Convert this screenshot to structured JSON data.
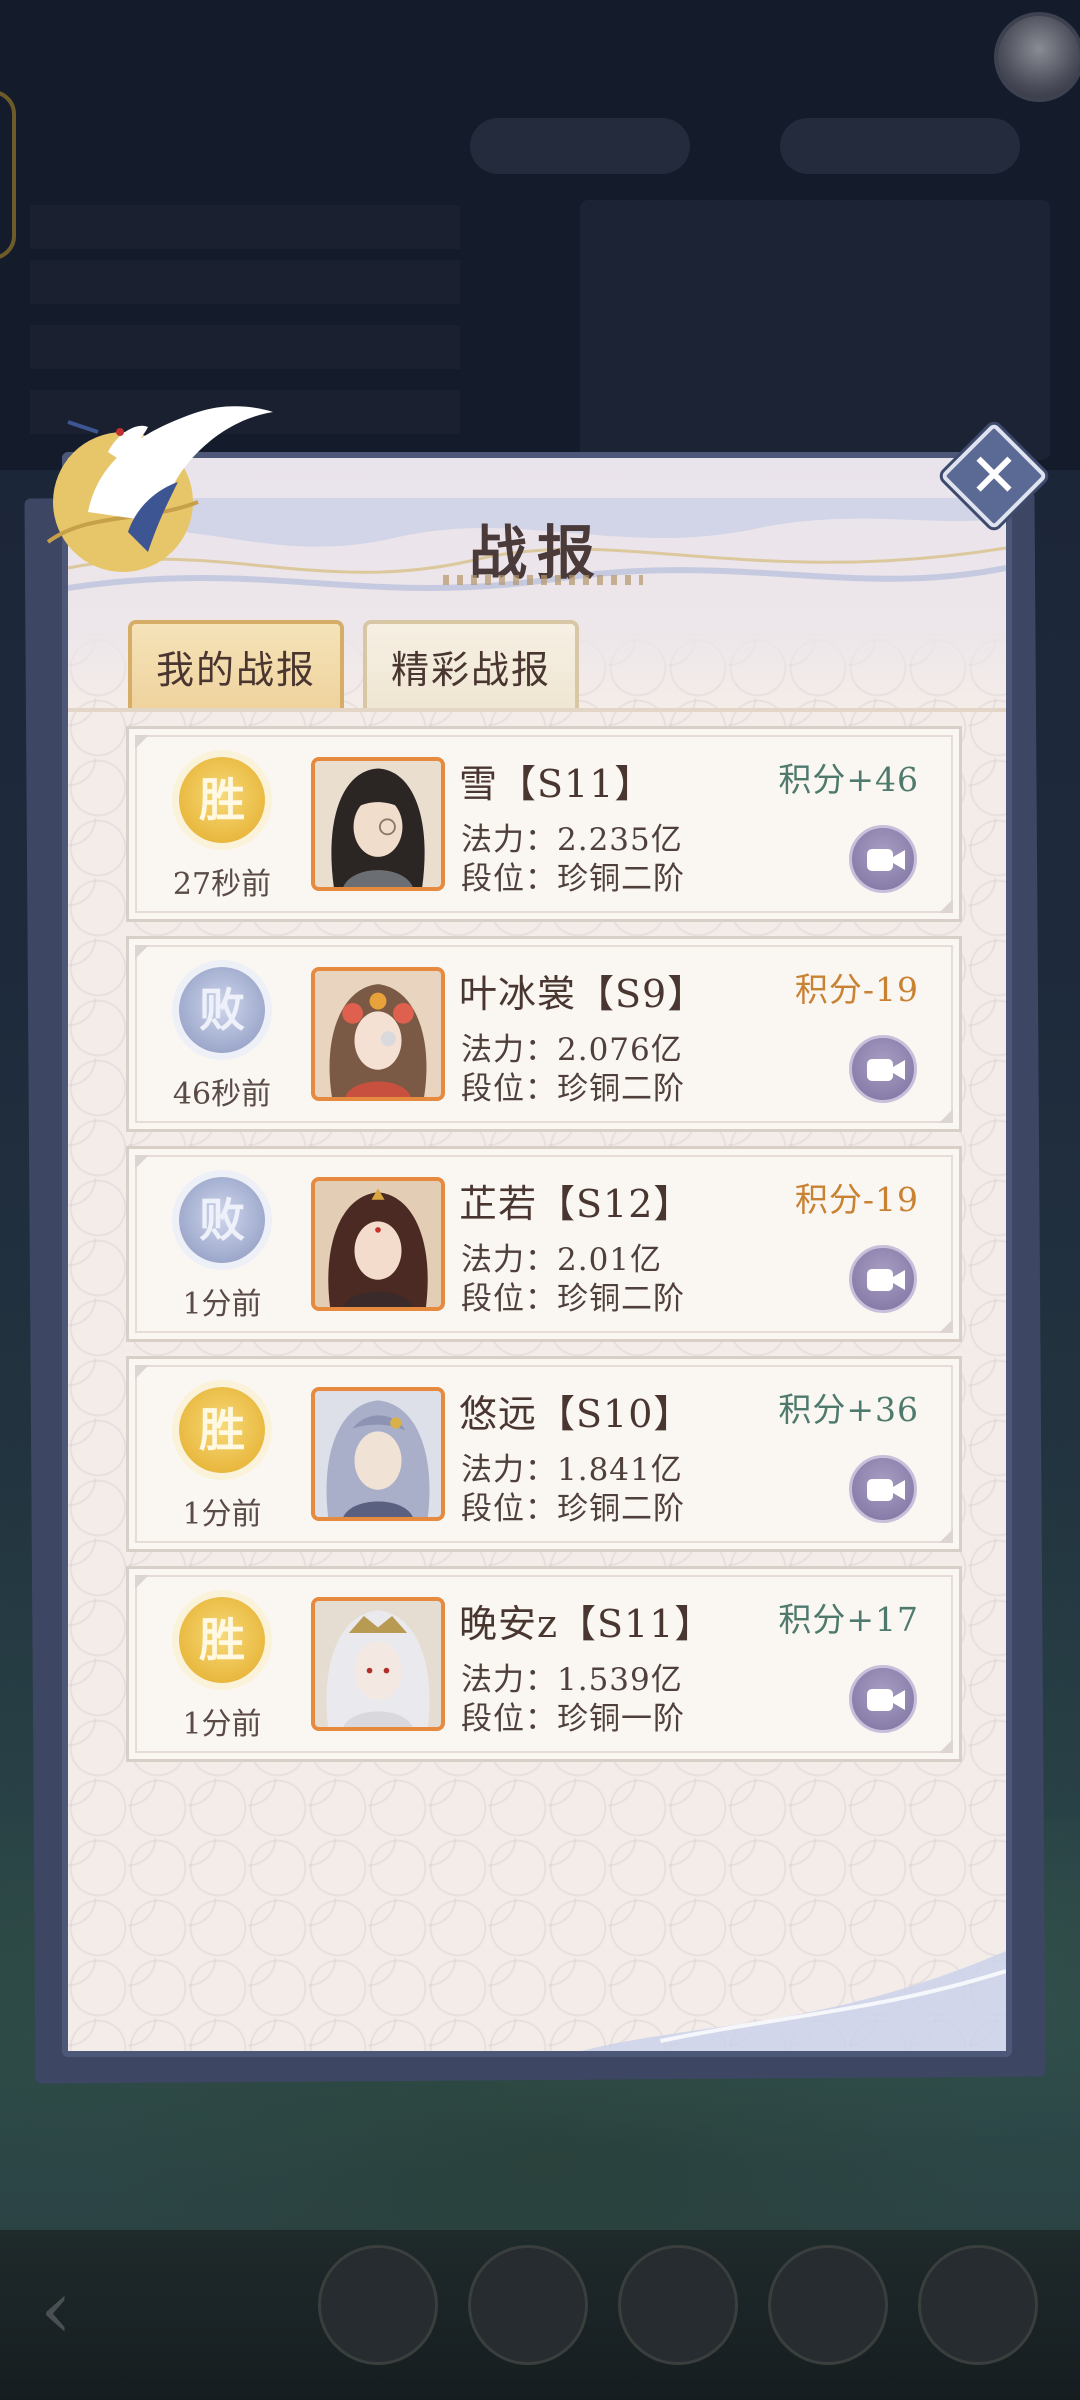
{
  "modal": {
    "title": "战报",
    "tabs": [
      {
        "label": "我的战报",
        "active": true
      },
      {
        "label": "精彩战报",
        "active": false
      }
    ]
  },
  "labels": {
    "power_prefix": "法力：",
    "rank_prefix": "段位："
  },
  "reports": [
    {
      "result": "胜",
      "outcome": "win",
      "time_ago": "27秒前",
      "name": "雪【S11】",
      "power": "2.235亿",
      "rank": "珍铜二阶",
      "score": "积分+46"
    },
    {
      "result": "败",
      "outcome": "lose",
      "time_ago": "46秒前",
      "name": "叶冰裳【S9】",
      "power": "2.076亿",
      "rank": "珍铜二阶",
      "score": "积分-19"
    },
    {
      "result": "败",
      "outcome": "lose",
      "time_ago": "1分前",
      "name": "芷若【S12】",
      "power": "2.01亿",
      "rank": "珍铜二阶",
      "score": "积分-19"
    },
    {
      "result": "胜",
      "outcome": "win",
      "time_ago": "1分前",
      "name": "悠远【S10】",
      "power": "1.841亿",
      "rank": "珍铜二阶",
      "score": "积分+36"
    },
    {
      "result": "胜",
      "outcome": "win",
      "time_ago": "1分前",
      "name": "晚安z【S11】",
      "power": "1.539亿",
      "rank": "珍铜一阶",
      "score": "积分+17"
    }
  ],
  "colors": {
    "win_score": "#4d7a6c",
    "lose_score": "#c98132",
    "modal_border": "#4d5777",
    "portrait_frame": "#e58a3e"
  },
  "icons": {
    "close": "close-icon",
    "replay": "video-camera-icon",
    "win": "win-badge-icon",
    "lose": "lose-badge-icon"
  }
}
